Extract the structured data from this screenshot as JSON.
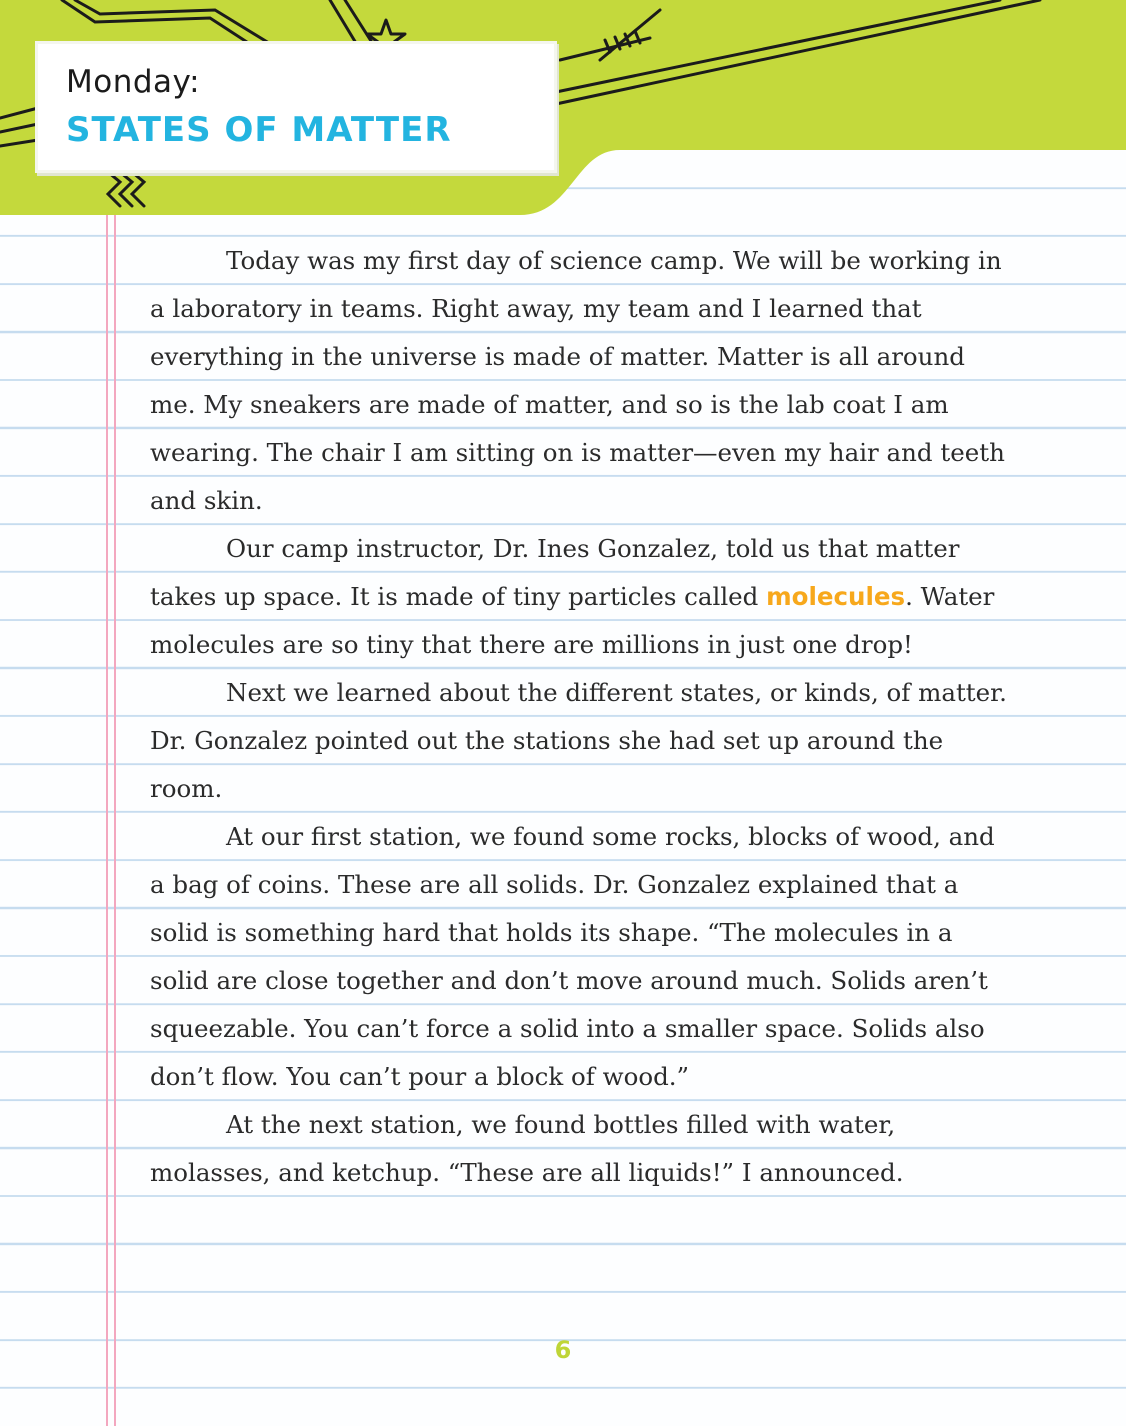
{
  "header": {
    "day_label": "Monday:",
    "chapter_title": "STATES OF MATTER"
  },
  "body": {
    "paragraphs": [
      "Today was my first day of science camp. We will be working in a laboratory in teams. Right away, my team and I learned that everything in the universe is made of matter. Matter is all around me. My sneakers are made of matter, and so is the lab coat I am wearing. The chair I am sitting on is matter—even my hair and teeth and skin.",
      {
        "before": "Our camp instructor, Dr. Ines Gonzalez, told us that matter takes up space. It is made of tiny particles called ",
        "term": "molecules",
        "after": ". Water molecules are so tiny that there are millions in just one drop!"
      },
      "Next we learned about the different states, or kinds, of matter. Dr. Gonzalez pointed out the stations she had set up around the room.",
      "At our first station, we found some rocks, blocks of wood, and a bag of coins. These are all solids. Dr. Gonzalez explained that a solid is something hard that holds its shape. “The molecules in a solid are close together and don’t move around much. Solids aren’t squeezable. You can’t force a solid into a smaller space. Solids also don’t flow. You can’t pour a block of wood.”",
      "At the next station, we found bottles filled with water, molasses, and ketchup. “These are all liquids!” I announced."
    ]
  },
  "footer": {
    "page_number": "6"
  },
  "colors": {
    "header_green": "#c4d93c",
    "title_blue": "#23b4e0",
    "term_orange": "#f7a81c",
    "rule_blue": "#c6dcef",
    "margin_pink": "#f3a7bf"
  }
}
